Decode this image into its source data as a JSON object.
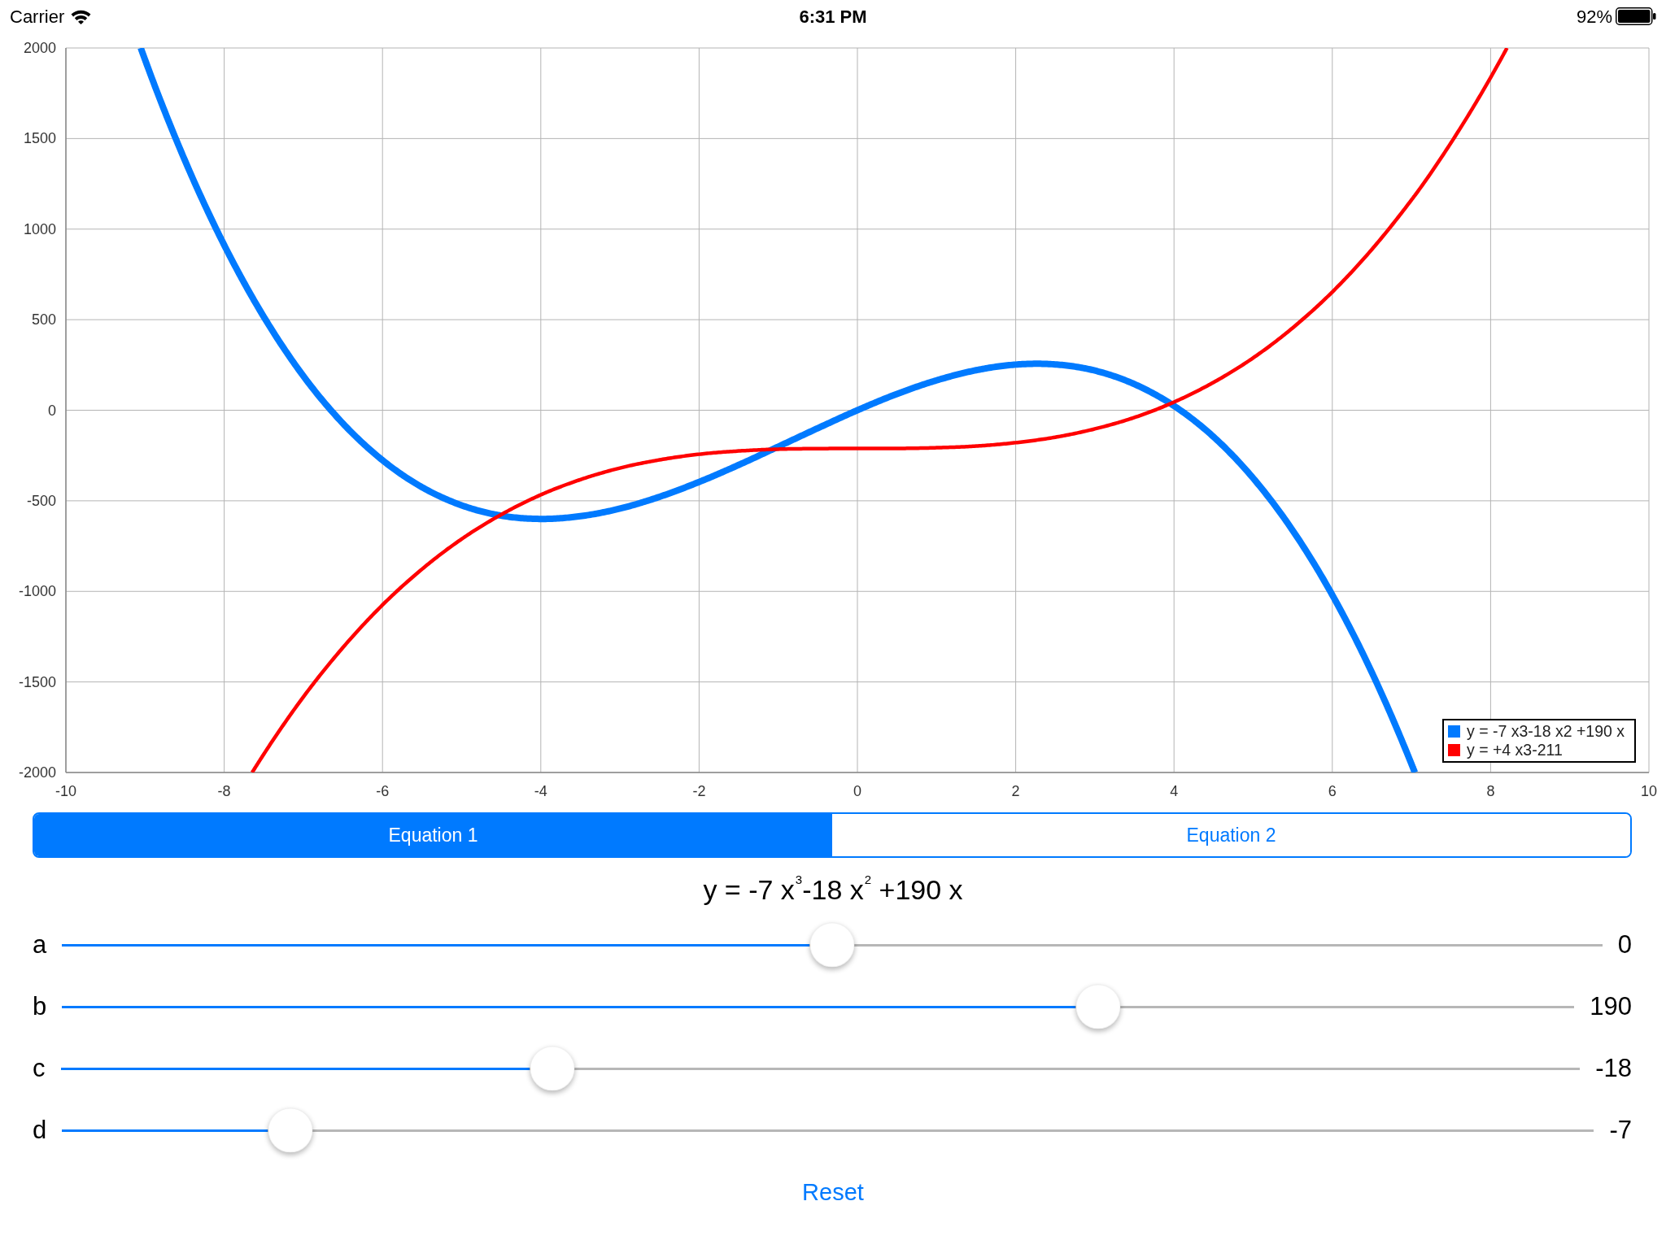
{
  "status_bar": {
    "carrier": "Carrier",
    "time": "6:31 PM",
    "battery": "92%"
  },
  "graph": {
    "chart_data": {
      "type": "line",
      "x": [
        -9.054,
        -9,
        -8.5,
        -8,
        -7.647,
        -7.5,
        -7,
        -6.5,
        -6,
        -5.5,
        -5,
        -4.5,
        -4,
        -3.5,
        -3,
        -2.5,
        -2,
        -1.5,
        -1,
        -0.5,
        0,
        0.5,
        1,
        1.5,
        2,
        2.5,
        3,
        3.5,
        4,
        4.5,
        5,
        5.5,
        6,
        6.5,
        7,
        7.043,
        7.5,
        8,
        8.207
      ],
      "series": [
        {
          "name": "y = -7 x3-18 x2 +190 x",
          "color": "#007aff",
          "values": [
            2000,
            1935,
            1383,
            912,
            625,
            516,
            189,
            -73,
            -276,
            -425,
            -525,
            -582,
            -600,
            -585,
            -543,
            -478,
            -396,
            -302,
            -201,
            -99,
            0,
            90,
            165,
            221,
            252,
            253,
            219,
            144,
            24,
            -147,
            -375,
            -664,
            -1020,
            -1448,
            -1953,
            -2000,
            null,
            null,
            null
          ]
        },
        {
          "name": "y = +4 x3-211",
          "color": "#ff0000",
          "values": [
            null,
            null,
            null,
            null,
            -2000,
            -1899,
            -1583,
            -1310,
            -1075,
            -877,
            -711,
            -576,
            -467,
            -383,
            -319,
            -274,
            -243,
            -225,
            -215,
            -212,
            -211,
            -211,
            -207,
            -198,
            -179,
            -149,
            -103,
            -40,
            45,
            154,
            289,
            455,
            653,
            888,
            1161,
            1186,
            1477,
            1837,
            2000
          ]
        }
      ],
      "xlim": [
        -10,
        10
      ],
      "ylim": [
        -2000,
        2000
      ],
      "xticks": [
        -10,
        -8,
        -6,
        -4,
        -2,
        0,
        2,
        4,
        6,
        8,
        10
      ],
      "yticks": [
        -2000,
        -1500,
        -1000,
        -500,
        0,
        500,
        1000,
        1500,
        2000
      ],
      "grid": true,
      "legend": "lower right"
    }
  },
  "equation_tabs": [
    {
      "label": "Equation 1",
      "selected": true
    },
    {
      "label": "Equation 2",
      "selected": false
    }
  ],
  "equation": "y = -7 x$^{3}$-18 x$^{2}$ +190 x",
  "sliders": [
    {
      "label": "a",
      "level": 0.5,
      "value": "0"
    },
    {
      "label": "b",
      "level": 0.685,
      "value": "190"
    },
    {
      "label": "c",
      "level": 0.3235,
      "value": "-18"
    },
    {
      "label": "d",
      "level": 0.149,
      "value": "-7"
    }
  ],
  "reset_button": "Reset"
}
